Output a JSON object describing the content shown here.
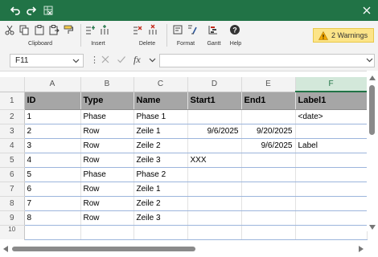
{
  "ribbon": {
    "clipboard_label": "Clipboard",
    "insert_label": "Insert",
    "delete_label": "Delete",
    "format_label": "Format",
    "gantt_label": "Gantt",
    "help_label": "Help",
    "warnings_label": "2 Warnings"
  },
  "formula_bar": {
    "name_box": "F11",
    "fx": "fx",
    "formula_value": ""
  },
  "columns": [
    "A",
    "B",
    "C",
    "D",
    "E",
    "F"
  ],
  "selected_column": "F",
  "rows": [
    {
      "num": "1",
      "cells": [
        "ID",
        "Type",
        "Name",
        "Start1",
        "End1",
        "Label1"
      ]
    },
    {
      "num": "2",
      "cells": [
        "1",
        "Phase",
        "Phase 1",
        "",
        "",
        "<date>"
      ]
    },
    {
      "num": "3",
      "cells": [
        "2",
        "Row",
        "Zeile 1",
        "9/6/2025",
        "9/20/2025",
        ""
      ]
    },
    {
      "num": "4",
      "cells": [
        "3",
        "Row",
        "Zeile 2",
        "",
        "9/6/2025",
        "Label"
      ]
    },
    {
      "num": "5",
      "cells": [
        "4",
        "Row",
        "Zeile 3",
        "XXX",
        "",
        ""
      ]
    },
    {
      "num": "6",
      "cells": [
        "5",
        "Phase",
        "Phase 2",
        "",
        "",
        ""
      ]
    },
    {
      "num": "7",
      "cells": [
        "6",
        "Row",
        "Zeile 1",
        "",
        "",
        ""
      ]
    },
    {
      "num": "8",
      "cells": [
        "7",
        "Row",
        "Zeile 2",
        "",
        "",
        ""
      ]
    },
    {
      "num": "9",
      "cells": [
        "8",
        "Row",
        "Zeile 3",
        "",
        "",
        ""
      ]
    },
    {
      "num": "10",
      "cells": [
        "",
        "",
        "",
        "",
        "",
        ""
      ]
    }
  ],
  "colors": {
    "accent": "#217346",
    "header_row_bg": "#a6a6a6",
    "warning_bg": "#fce488",
    "row_border": "#9cb5dc"
  },
  "icons": [
    "undo-icon",
    "redo-icon",
    "excel-icon",
    "close-icon",
    "cut-icon",
    "copy-icon",
    "paste-icon",
    "paste-special-icon",
    "format-painter-icon",
    "insert-row-icon",
    "insert-column-icon",
    "delete-row-icon",
    "delete-column-icon",
    "format-icon",
    "format-cells-icon",
    "gantt-icon",
    "help-icon",
    "warning-icon",
    "cancel-icon",
    "enter-icon"
  ]
}
